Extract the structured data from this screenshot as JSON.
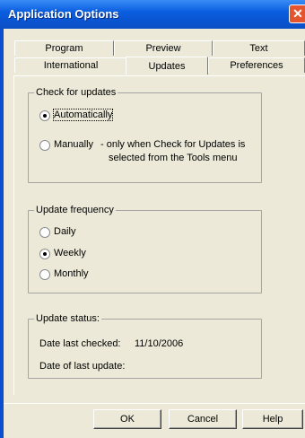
{
  "window": {
    "title": "Application Options"
  },
  "tabs": {
    "row1": [
      "Program",
      "Preview",
      "Text"
    ],
    "row2": [
      "International",
      "Updates",
      "Preferences"
    ],
    "active": "Updates"
  },
  "check_for_updates": {
    "title": "Check for updates",
    "automatic": {
      "label": "Automatically",
      "selected": true
    },
    "manual": {
      "label": "Manually",
      "note_line1": "- only when Check for Updates is",
      "note_line2": "selected from the Tools menu",
      "selected": false
    }
  },
  "update_frequency": {
    "title": "Update frequency",
    "options": [
      {
        "label": "Daily",
        "selected": false
      },
      {
        "label": "Weekly",
        "selected": true
      },
      {
        "label": "Monthly",
        "selected": false
      }
    ]
  },
  "update_status": {
    "title": "Update status:",
    "last_checked_label": "Date last checked:",
    "last_checked_value": "11/10/2006",
    "last_update_label": "Date of last update:",
    "last_update_value": ""
  },
  "buttons": {
    "ok": "OK",
    "cancel": "Cancel",
    "help": "Help"
  }
}
